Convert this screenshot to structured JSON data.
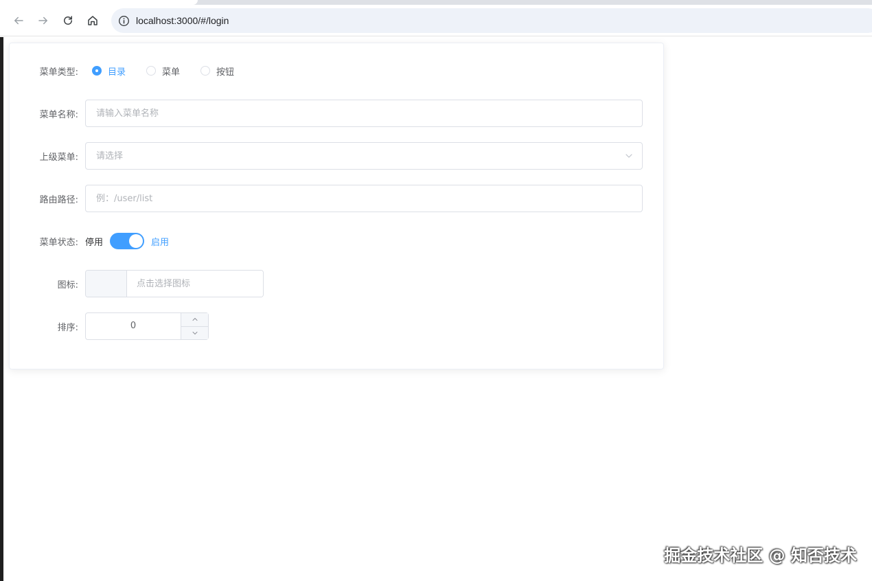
{
  "browser": {
    "url": "localhost:3000/#/login"
  },
  "form": {
    "menu_type": {
      "label": "菜单类型:",
      "options": [
        {
          "label": "目录",
          "checked": true
        },
        {
          "label": "菜单",
          "checked": false
        },
        {
          "label": "按钮",
          "checked": false
        }
      ]
    },
    "menu_name": {
      "label": "菜单名称:",
      "value": "",
      "placeholder": "请输入菜单名称"
    },
    "parent_menu": {
      "label": "上级菜单:",
      "value": "",
      "placeholder": "请选择"
    },
    "route_path": {
      "label": "路由路径:",
      "value": "",
      "placeholder": "例：/user/list"
    },
    "menu_status": {
      "label": "菜单状态:",
      "off_text": "停用",
      "on_text": "启用",
      "enabled": true
    },
    "icon": {
      "label": "图标:",
      "placeholder": "点击选择图标"
    },
    "sort": {
      "label": "排序:",
      "value": "0"
    }
  },
  "watermark": "掘金技术社区 @ 知否技术",
  "colors": {
    "primary": "#409eff",
    "border": "#dcdfe6",
    "text": "#606266"
  }
}
